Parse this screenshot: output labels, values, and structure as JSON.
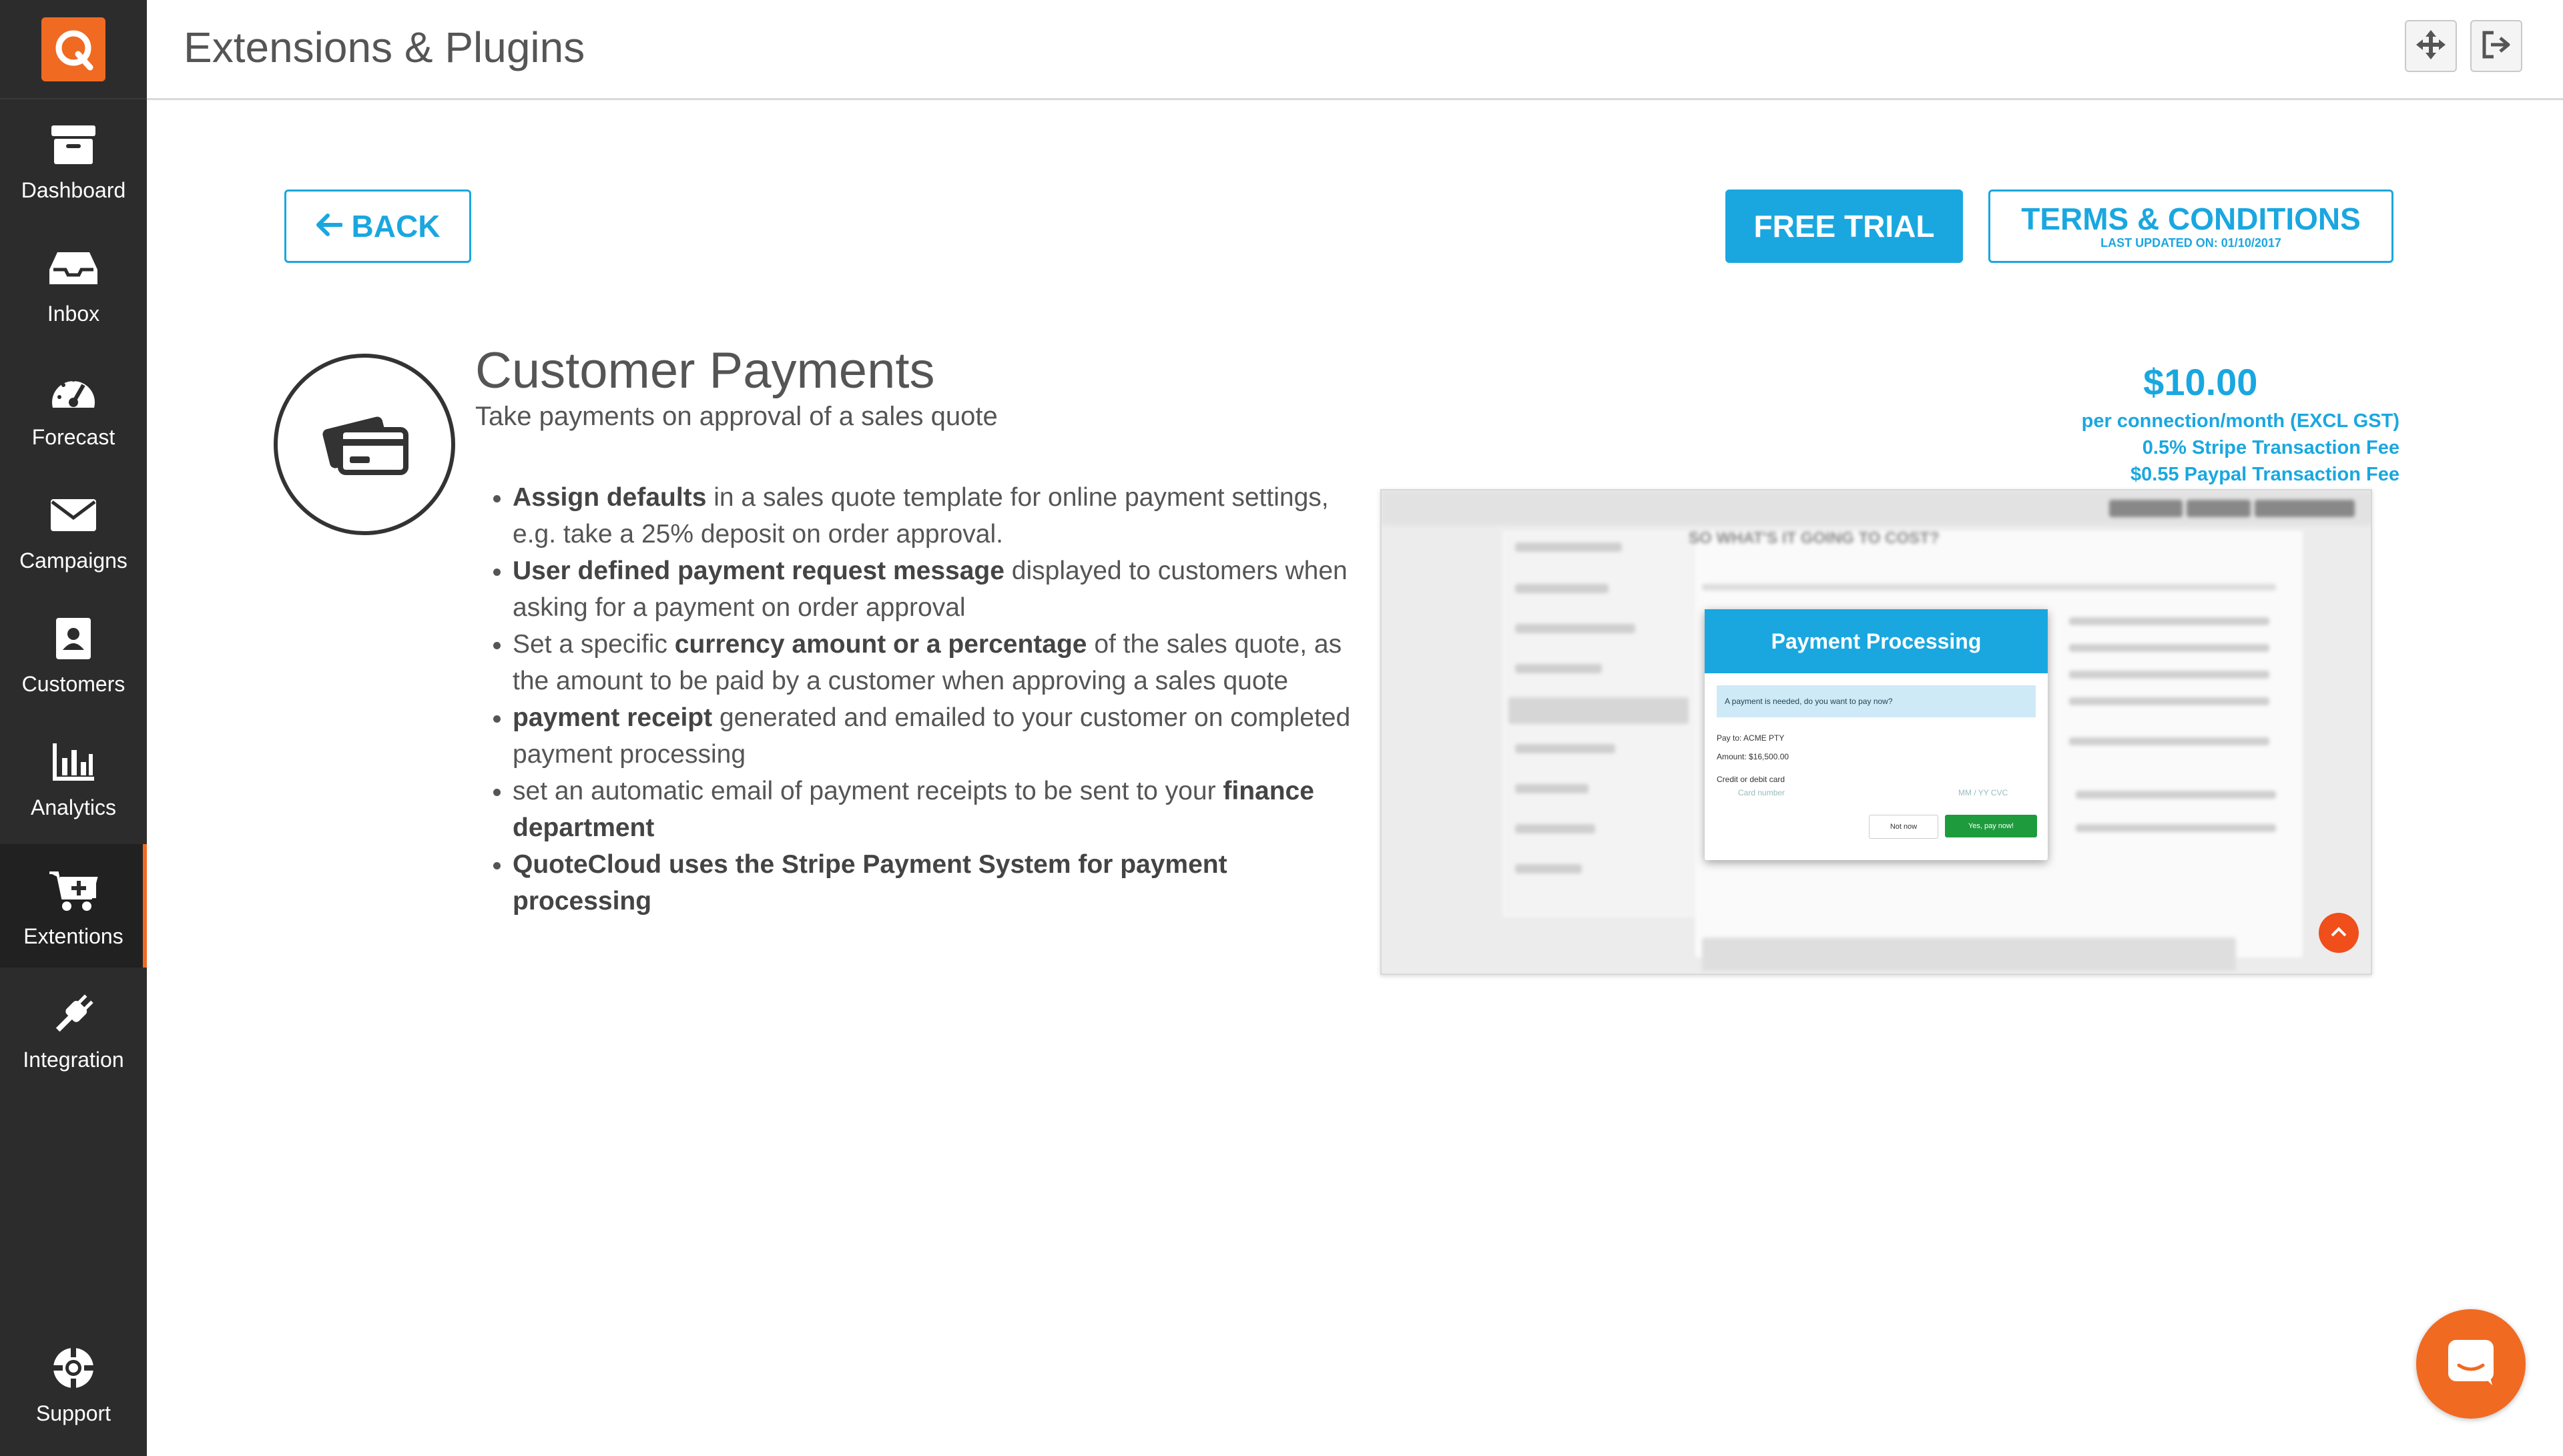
{
  "app": {
    "logo_letter": "Q",
    "accent": "#f06a22",
    "primary": "#1aa7e0"
  },
  "header": {
    "title": "Extensions & Plugins"
  },
  "sidebar": {
    "items": [
      {
        "label": "Dashboard",
        "icon": "archive-icon"
      },
      {
        "label": "Inbox",
        "icon": "inbox-icon"
      },
      {
        "label": "Forecast",
        "icon": "gauge-icon"
      },
      {
        "label": "Campaigns",
        "icon": "envelope-icon"
      },
      {
        "label": "Customers",
        "icon": "contact-card-icon"
      },
      {
        "label": "Analytics",
        "icon": "bar-chart-icon"
      },
      {
        "label": "Extentions",
        "icon": "cart-plus-icon",
        "active": true
      },
      {
        "label": "Integration",
        "icon": "plug-icon"
      }
    ],
    "support": {
      "label": "Support",
      "icon": "lifebuoy-icon"
    }
  },
  "actions": {
    "back": "BACK",
    "free_trial": "FREE TRIAL",
    "terms": "TERMS & CONDITIONS",
    "terms_updated": "LAST UPDATED ON: 01/10/2017"
  },
  "extension": {
    "title": "Customer Payments",
    "subtitle": "Take payments on approval of a sales quote",
    "price": "$10.00",
    "price_period": "per connection/month (EXCL GST)",
    "stripe_fee": "0.5% Stripe Transaction Fee",
    "paypal_fee": "$0.55 Paypal Transaction Fee",
    "features": [
      {
        "bold": "Assign defaults",
        "text": " in a sales quote template for online payment settings, e.g. take a 25% deposit on order approval."
      },
      {
        "bold": "User defined payment request message",
        "text": " displayed to customers when asking for a payment on order approval"
      },
      {
        "pre": "Set a specific ",
        "bold": "currency amount or a percentage",
        "text": " of the sales quote, as the amount to be paid by a customer when approving a sales quote"
      },
      {
        "bold": "payment receipt",
        "text": " generated and emailed to your customer on completed payment processing"
      },
      {
        "pre": "set an automatic email of payment receipts to be sent to your ",
        "bold": "finance department",
        "text": ""
      },
      {
        "bold": "QuoteCloud uses the Stripe Payment System for payment processing",
        "text": ""
      }
    ]
  },
  "preview": {
    "heading": "SO WHAT'S IT GOING TO COST?",
    "modal_title": "Payment Processing",
    "alert": "A payment is needed, do you want to pay now?",
    "pay_to": "Pay to: ACME PTY",
    "amount": "Amount: $16,500.00",
    "card_label": "Credit or debit card",
    "card_placeholder": "Card number",
    "card_exp": "MM / YY  CVC",
    "not_now": "Not now",
    "yes_pay": "Yes, pay now!"
  }
}
